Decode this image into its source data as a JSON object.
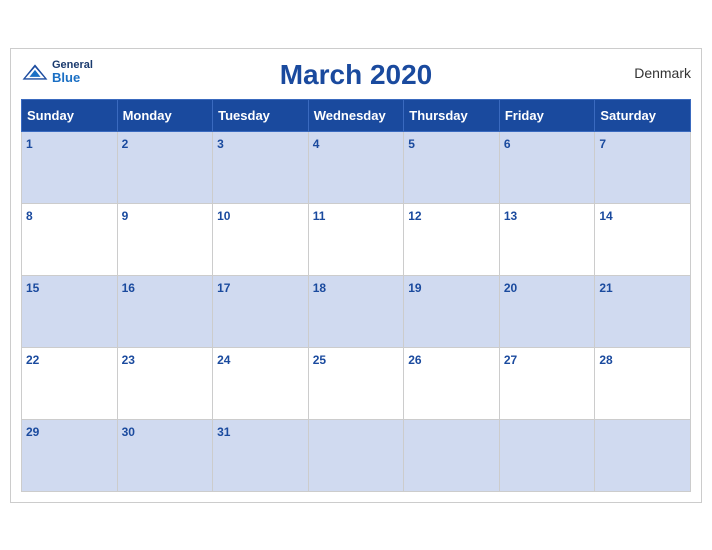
{
  "header": {
    "logo_general": "General",
    "logo_blue": "Blue",
    "title": "March 2020",
    "country": "Denmark"
  },
  "weekdays": [
    "Sunday",
    "Monday",
    "Tuesday",
    "Wednesday",
    "Thursday",
    "Friday",
    "Saturday"
  ],
  "weeks": [
    {
      "shaded": true,
      "days": [
        1,
        2,
        3,
        4,
        5,
        6,
        7
      ]
    },
    {
      "shaded": false,
      "days": [
        8,
        9,
        10,
        11,
        12,
        13,
        14
      ]
    },
    {
      "shaded": true,
      "days": [
        15,
        16,
        17,
        18,
        19,
        20,
        21
      ]
    },
    {
      "shaded": false,
      "days": [
        22,
        23,
        24,
        25,
        26,
        27,
        28
      ]
    },
    {
      "shaded": true,
      "days": [
        29,
        30,
        31,
        null,
        null,
        null,
        null
      ]
    }
  ]
}
